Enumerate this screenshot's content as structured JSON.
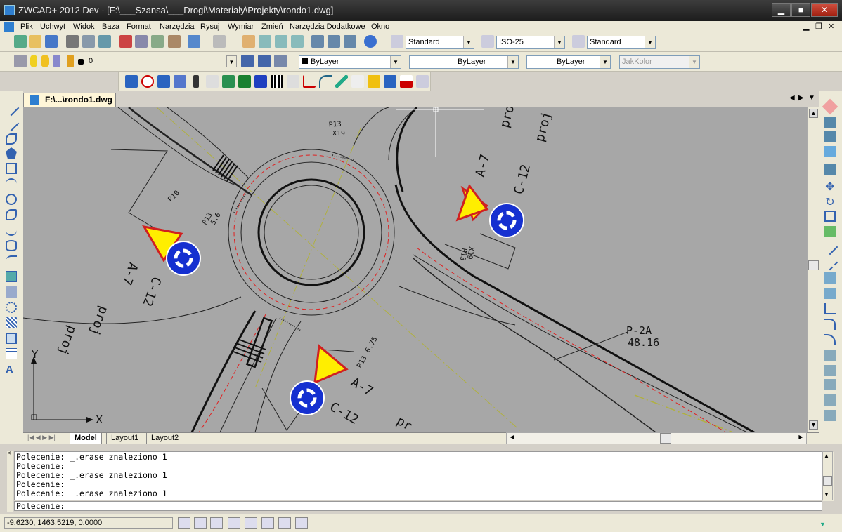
{
  "window": {
    "title": "ZWCAD+ 2012 Dev - [F:\\___Szansa\\___Drogi\\Materiały\\Projekty\\rondo1.dwg]",
    "minimize": "▁",
    "maximize": "■",
    "close": "✕"
  },
  "menu": [
    "Plik",
    "Uchwyt",
    "Widok",
    "Baza",
    "Format",
    "Narzędzia",
    "Rysuj",
    "Wymiar",
    "Zmień",
    "Narzędzia Dodatkowe",
    "Okno"
  ],
  "toolbar": {
    "text_style": "Standard",
    "dim_style": "ISO-25",
    "table_style": "Standard",
    "layer": "0",
    "color": "ByLayer",
    "linetype": "ByLayer",
    "lineweight": "ByLayer",
    "plotstyle": "JakKolor"
  },
  "document": {
    "tab": "F:\\...\\rondo1.dwg"
  },
  "drawing": {
    "labels": {
      "p13_top": "P13",
      "x19": "X19",
      "p10": "P10",
      "p13_left": "P13",
      "v56": "5.6",
      "p13_right": "P13",
      "x19_right": "X19",
      "p13_bottom": "P13",
      "v675": "6.75",
      "p2a": "P-2A",
      "v4816": "48.16",
      "a7_right": "A-7",
      "c12_right": "C-12",
      "proj_right": "proj",
      "a7_left": "A-7",
      "c12_left": "C-12",
      "proj_left": "proj",
      "a7_bottom": "A-7",
      "c12_bottom": "C-12",
      "proj_bottom": "pr",
      "axis_y": "Y",
      "axis_x": "X"
    }
  },
  "layout_tabs": [
    "Model",
    "Layout1",
    "Layout2"
  ],
  "command_history": [
    "Polecenie: _.erase znaleziono 1",
    "Polecenie:",
    "Polecenie: _.erase znaleziono 1",
    "Polecenie:",
    "Polecenie: _.erase znaleziono 1"
  ],
  "command_prompt": "Polecenie:",
  "status": {
    "coordinates": "-9.6230,  1463.5219, 0.0000"
  }
}
